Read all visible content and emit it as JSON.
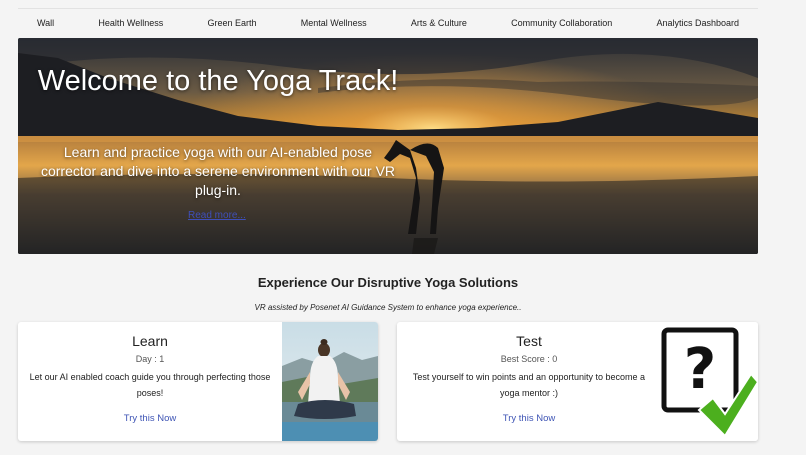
{
  "nav": {
    "items": [
      "Wall",
      "Health Wellness",
      "Green Earth",
      "Mental Wellness",
      "Arts & Culture",
      "Community Collaboration",
      "Analytics Dashboard"
    ]
  },
  "hero": {
    "title": "Welcome to the Yoga Track!",
    "description": "Learn and practice yoga with our AI-enabled pose corrector and dive into a serene environment with our VR plug-in.",
    "link_label": "Read more..."
  },
  "section": {
    "title": "Experience Our Disruptive Yoga Solutions",
    "subtitle": "VR assisted by Posenet AI Guidance System to enhance yoga experience.."
  },
  "cards": [
    {
      "title": "Learn",
      "meta": "Day : 1",
      "text": "Let our AI enabled coach guide you through perfecting those poses!",
      "link": "Try this Now",
      "image_icon": "meditation-photo"
    },
    {
      "title": "Test",
      "meta": "Best Score : 0",
      "text": "Test yourself to win points and an opportunity to become a yoga mentor :)",
      "link": "Try this Now",
      "image_icon": "question-checkmark-icon"
    }
  ],
  "colors": {
    "link": "#3f55b5",
    "check": "#4caf1e"
  }
}
